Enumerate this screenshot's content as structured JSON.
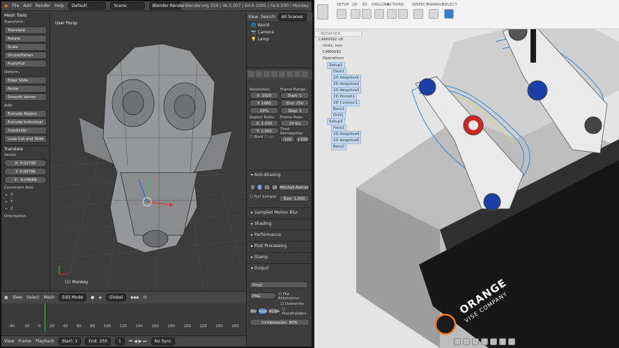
{
  "blender": {
    "menu": [
      "File",
      "Add",
      "Render",
      "Help"
    ],
    "layout": "Default",
    "scene": "Scene",
    "engine": "Blender Render",
    "stats": "blender.org 259 | Ve:3,507 | Ed:0-1005 | Fa:0-500 | Monkey",
    "tools_title": "Mesh Tools",
    "transform_label": "Transform:",
    "transform_buttons": [
      "Translate",
      "Rotate",
      "Scale",
      "Shrink/Fatten",
      "Push/Pull"
    ],
    "deform_label": "Deform:",
    "deform_buttons": [
      "Edge Slide",
      "Noise",
      "Smooth Vertex"
    ],
    "add_label": "Add:",
    "add_buttons": [
      "Extrude Region",
      "Extrude Individual",
      "Subdivide",
      "Loop Cut and Slide"
    ],
    "op_title": "Translate",
    "vector_label": "Vector",
    "vector": [
      "X: 0.02790",
      "Y: 0.00796",
      "Z: -0.04669"
    ],
    "constraint_label": "Constraint Axis",
    "axes": [
      "X",
      "Y",
      "Z"
    ],
    "orientation_label": "Orientation",
    "viewport_label": "User Persp",
    "object_label": "(1) Monkey",
    "view_header": {
      "view": "View",
      "select": "Select",
      "mesh": "Mesh",
      "mode": "Edit Mode",
      "orientation": "Global"
    },
    "timeline_ticks": [
      "-40",
      "-20",
      "0",
      "20",
      "40",
      "60",
      "80",
      "100",
      "120",
      "140",
      "160",
      "180",
      "200",
      "220",
      "240",
      "260"
    ],
    "timeline_bar": {
      "view": "View",
      "frame": "Frame",
      "playback": "Playback",
      "start": "Start: 1",
      "end": "End: 250",
      "current": "1",
      "sync": "No Sync"
    },
    "outliner": {
      "view": "View",
      "search": "Search",
      "filter": "All Scenes",
      "items": [
        "World",
        "Camera",
        "Lamp"
      ]
    },
    "render": {
      "resolution_label": "Resolution:",
      "res_x": "X: 1920",
      "res_y": "Y: 1080",
      "res_pct": "50%",
      "frame_range_label": "Frame Range:",
      "start": "Start: 1",
      "end": "End: 250",
      "step": "Step: 1",
      "aspect_label": "Aspect Ratio:",
      "aspect_x": "X: 1.000",
      "aspect_y": "Y: 1.000",
      "frame_rate_label": "Frame Rate:",
      "fps": "24 fps",
      "remap_label": "Time Remapping:",
      "remap_old": "-100",
      "remap_new": "+100",
      "bord": "Bord",
      "crop": "Crop",
      "aa_title": "Anti-Aliasing",
      "aa_levels": [
        "5",
        "8",
        "11",
        "16"
      ],
      "aa_filter": "Mitchell-Netrav",
      "full_sample": "Full Sample",
      "aa_size": "Size: 1.000",
      "sections": [
        "Sampled Motion Blur",
        "Shading",
        "Performance",
        "Post Processing",
        "Stamp",
        "Output"
      ],
      "output_path": "/tmp/",
      "format": "PNG",
      "file_ext": "File Extensions",
      "overwrite": "Overwrite",
      "placeholders": "Placeholders",
      "color_modes": [
        "BW",
        "RGB",
        "RGBA"
      ],
      "compression": "Compression: 90%"
    }
  },
  "fusion": {
    "tabs": [
      "SETUP",
      "2D",
      "3D",
      "DRILLING",
      "ACTIONS",
      "INSPECT",
      "MANAGE",
      "SELECT"
    ],
    "browser_title": "BROWSER",
    "tree": [
      {
        "label": "CAM0092 v8",
        "indent": 0,
        "selected": false
      },
      {
        "label": "Units: mm",
        "indent": 1,
        "selected": false
      },
      {
        "label": "CAM0092",
        "indent": 1,
        "selected": false
      },
      {
        "label": "Operations",
        "indent": 1,
        "selected": false
      },
      {
        "label": "Setup1",
        "indent": 2,
        "selected": true
      },
      {
        "label": "Face1",
        "indent": 3,
        "selected": true
      },
      {
        "label": "2D Adaptive1",
        "indent": 3,
        "selected": true
      },
      {
        "label": "2D Adaptive2",
        "indent": 3,
        "selected": true
      },
      {
        "label": "2D Adaptive3",
        "indent": 3,
        "selected": true
      },
      {
        "label": "2D Pocket1",
        "indent": 3,
        "selected": true
      },
      {
        "label": "2D Contour1",
        "indent": 3,
        "selected": true
      },
      {
        "label": "Bore1",
        "indent": 3,
        "selected": true
      },
      {
        "label": "Drill1",
        "indent": 3,
        "selected": true
      },
      {
        "label": "Setup2",
        "indent": 2,
        "selected": true
      },
      {
        "label": "Face2",
        "indent": 3,
        "selected": true
      },
      {
        "label": "2D Adaptive4",
        "indent": 3,
        "selected": true
      },
      {
        "label": "2D Adaptive5",
        "indent": 3,
        "selected": true
      },
      {
        "label": "Bore2",
        "indent": 3,
        "selected": true
      }
    ],
    "vise_brand": "ORANGE",
    "vise_sub": "VISE COMPANY"
  }
}
